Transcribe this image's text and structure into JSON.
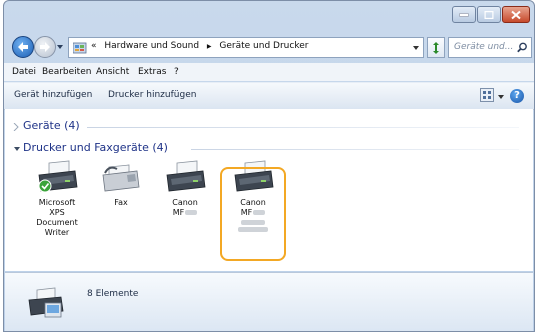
{
  "window": {
    "controls": {
      "minimize": "minimize",
      "maximize": "maximize",
      "close": "close"
    }
  },
  "address_bar": {
    "overflow": "«",
    "crumbs": [
      "Hardware und Sound",
      "Geräte und Drucker"
    ],
    "separator": "▶"
  },
  "search": {
    "placeholder": "Geräte und..."
  },
  "menu": {
    "items": [
      "Datei",
      "Bearbeiten",
      "Ansicht",
      "Extras",
      "?"
    ]
  },
  "toolbar": {
    "add_device": "Gerät hinzufügen",
    "add_printer": "Drucker hinzufügen"
  },
  "groups": {
    "devices": {
      "label": "Geräte (4)",
      "expanded": false
    },
    "printers": {
      "label": "Drucker und Faxgeräte (4)",
      "expanded": true
    }
  },
  "printers": [
    {
      "lines": [
        "Microsoft",
        "XPS",
        "Document",
        "Writer"
      ],
      "icon": "printer-default-icon",
      "default": true
    },
    {
      "lines": [
        "Fax"
      ],
      "icon": "fax-icon",
      "default": false
    },
    {
      "lines": [
        "Canon",
        "MF"
      ],
      "icon": "printer-icon",
      "default": false
    },
    {
      "lines": [
        "Canon",
        "MF"
      ],
      "icon": "printer-icon",
      "default": false,
      "selected": true
    }
  ],
  "details": {
    "count_label": "8 Elemente"
  },
  "colors": {
    "selection": "#f3a824",
    "group_text": "#1e3287"
  }
}
